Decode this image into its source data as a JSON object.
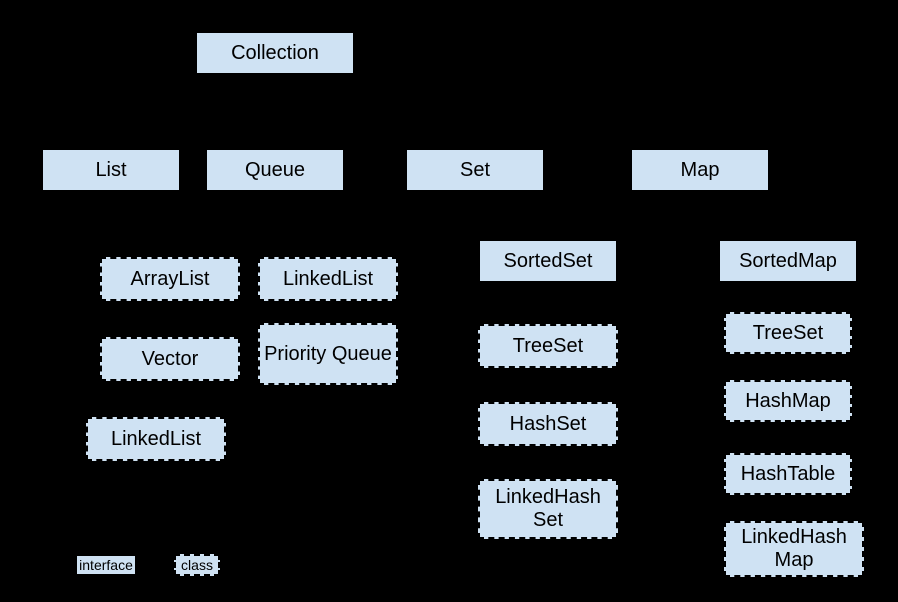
{
  "root": {
    "label": "Collection"
  },
  "interfaces": {
    "list": "List",
    "queue": "Queue",
    "set": "Set",
    "map": "Map",
    "sortedSet": "SortedSet",
    "sortedMap": "SortedMap"
  },
  "classes": {
    "arrayList": "ArrayList",
    "vector": "Vector",
    "linkedList_list": "LinkedList",
    "linkedList_queue": "LinkedList",
    "priorityQueue": "Priority Queue",
    "treeSet_set": "TreeSet",
    "hashSet": "HashSet",
    "linkedHashSet": "LinkedHash Set",
    "treeSet_map": "TreeSet",
    "hashMap": "HashMap",
    "hashTable": "HashTable",
    "linkedHashMap": "LinkedHash Map"
  },
  "legend": {
    "interface": "interface",
    "class": "class"
  }
}
